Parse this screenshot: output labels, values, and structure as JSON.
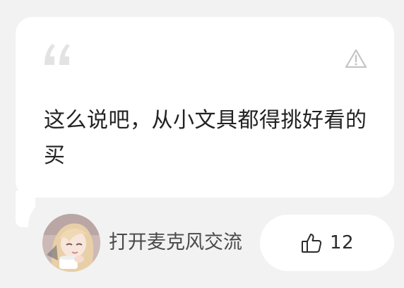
{
  "quote": {
    "text": "这么说吧，从小文具都得挑好看的买"
  },
  "author": {
    "name": "打开麦克风交流"
  },
  "like": {
    "count": "12"
  },
  "icons": {
    "quote": "quote-mark-icon",
    "report": "warning-triangle-icon",
    "like": "thumbs-up-icon"
  },
  "colors": {
    "background": "#f2f2f2",
    "card": "#ffffff",
    "text": "#222222",
    "muted_icon": "#c8c8c8"
  }
}
